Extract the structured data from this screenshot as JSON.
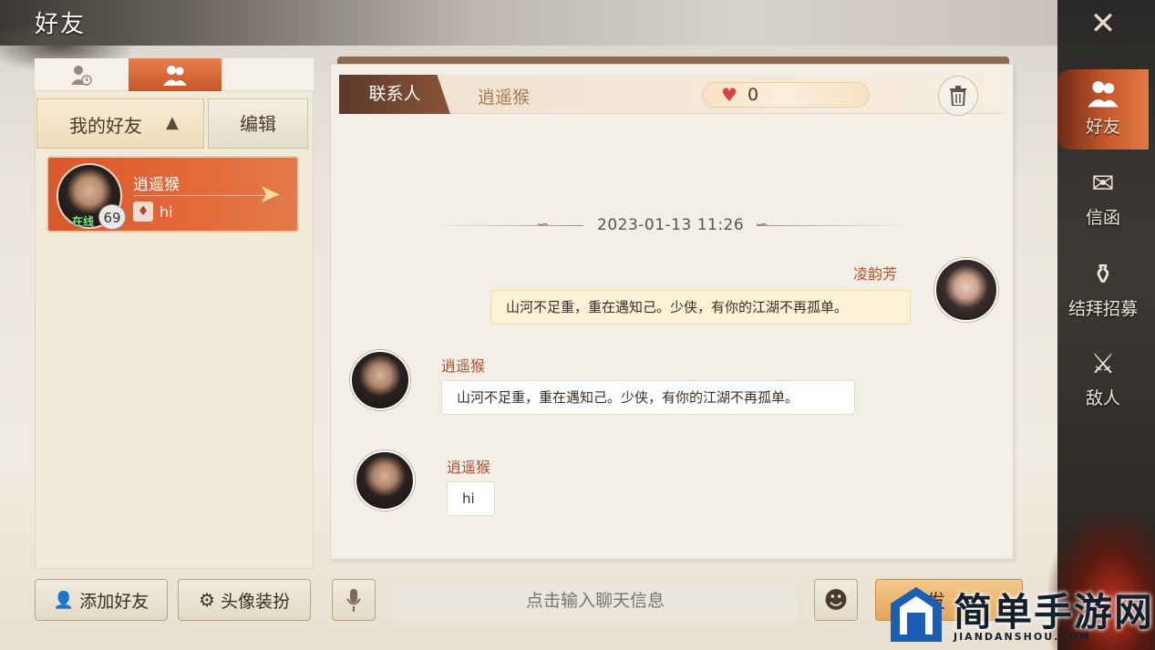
{
  "page_title": "好友",
  "left_tabs": [
    {
      "name": "recent",
      "icon": "recent-contacts-icon",
      "active": false
    },
    {
      "name": "friends",
      "icon": "friends-icon",
      "active": true
    }
  ],
  "friend_group": {
    "label": "我的好友",
    "caret": "▲",
    "edit_label": "编辑"
  },
  "friends": [
    {
      "name": "逍遥猴",
      "status": "在线",
      "level": "69",
      "last_message": "hi",
      "message_icon": "gift-icon",
      "selected": true
    }
  ],
  "chat": {
    "contact_tab_label": "联系人",
    "contact_name": "逍遥猴",
    "intimacy": "0",
    "timestamp": "2023-01-13  11:26",
    "messages": [
      {
        "sender": "凌韵芳",
        "side": "right",
        "text": "山河不足重，重在遇知己。少侠，有你的江湖不再孤单。"
      },
      {
        "sender": "逍遥猴",
        "side": "left",
        "text": "山河不足重，重在遇知己。少侠，有你的江湖不再孤单。"
      },
      {
        "sender": "逍遥猴",
        "side": "left",
        "text": "hi"
      }
    ]
  },
  "bottom_bar": {
    "add_friend_label": "添加好友",
    "avatar_dress_label": "头像装扮",
    "input_placeholder": "点击输入聊天信息",
    "send_label": "发"
  },
  "rail": {
    "items": [
      {
        "label": "好友",
        "icon": "friends-icon",
        "active": true
      },
      {
        "label": "信函",
        "icon": "letter-icon",
        "active": false
      },
      {
        "label": "结拜招募",
        "icon": "sworn-recruit-icon",
        "active": false
      },
      {
        "label": "敌人",
        "icon": "enemy-icon",
        "active": false
      }
    ]
  },
  "watermark": {
    "title": "简单手游网",
    "subtitle": "JIANDANSHOU.COM"
  },
  "colors": {
    "accent": "#d9582d",
    "sender": "#b4522e",
    "rail": "#2e2a27",
    "heart": "#d8404a"
  }
}
